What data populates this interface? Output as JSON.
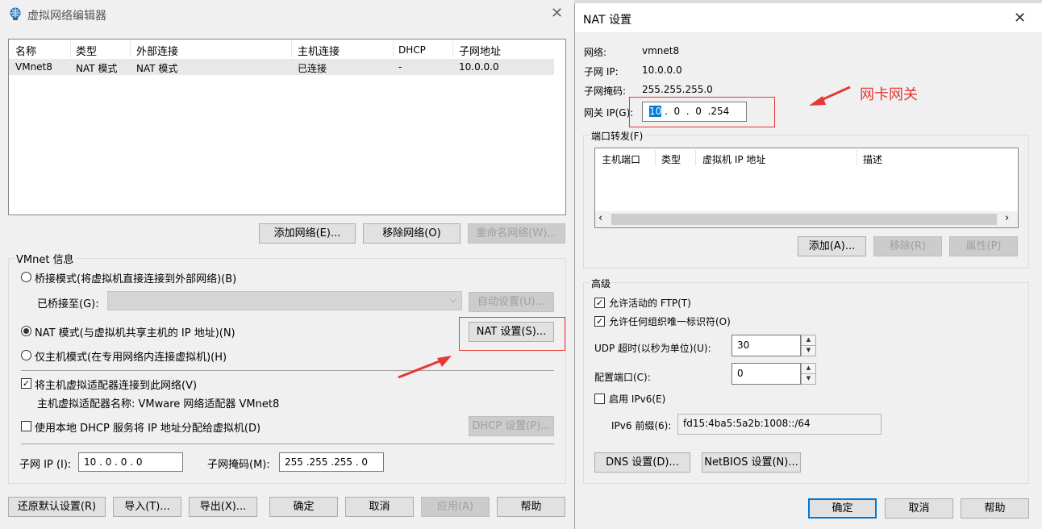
{
  "left": {
    "title": "虚拟网络编辑器",
    "table": {
      "headers": [
        "名称",
        "类型",
        "外部连接",
        "主机连接",
        "DHCP",
        "子网地址"
      ],
      "rows": [
        [
          "VMnet8",
          "NAT 模式",
          "NAT 模式",
          "已连接",
          "-",
          "10.0.0.0"
        ]
      ]
    },
    "buttons": {
      "add_network": "添加网络(E)...",
      "remove_network": "移除网络(O)",
      "rename_network": "重命名网络(W)..."
    },
    "vmnet_info": {
      "group_label": "VMnet 信息",
      "bridged": "桥接模式(将虚拟机直接连接到外部网络)(B)",
      "bridged_to_label": "已桥接至(G):",
      "auto_settings": "自动设置(U)...",
      "nat": "NAT 模式(与虚拟机共享主机的 IP 地址)(N)",
      "nat_settings": "NAT 设置(S)...",
      "host_only": "仅主机模式(在专用网络内连接虚拟机)(H)",
      "connect_adapter": "将主机虚拟适配器连接到此网络(V)",
      "adapter_name": "主机虚拟适配器名称: VMware 网络适配器 VMnet8",
      "use_dhcp": "使用本地 DHCP 服务将 IP 地址分配给虚拟机(D)",
      "dhcp_settings": "DHCP 设置(P)...",
      "subnet_ip_label": "子网 IP (I):",
      "subnet_ip": "10 . 0 . 0 . 0",
      "subnet_mask_label": "子网掩码(M):",
      "subnet_mask": "255 .255 .255 . 0"
    },
    "bottom": {
      "restore": "还原默认设置(R)",
      "import": "导入(T)...",
      "export": "导出(X)...",
      "ok": "确定",
      "cancel": "取消",
      "apply": "应用(A)",
      "help": "帮助"
    }
  },
  "right": {
    "title": "NAT 设置",
    "network_label": "网络:",
    "network": "vmnet8",
    "subnet_ip_label": "子网 IP:",
    "subnet_ip": "10.0.0.0",
    "subnet_mask_label": "子网掩码:",
    "subnet_mask": "255.255.255.0",
    "gateway_label": "网关 IP(G):",
    "gateway_sel": "10",
    "gateway_rest": " .  0  .  0  .254",
    "port_forward_label": "端口转发(F)",
    "pf_headers": [
      "主机端口",
      "类型",
      "虚拟机 IP 地址",
      "描述"
    ],
    "pf_add": "添加(A)...",
    "pf_remove": "移除(R)",
    "pf_props": "属性(P)",
    "advanced_label": "高级",
    "allow_ftp": "允许活动的 FTP(T)",
    "allow_uid": "允许任何组织唯一标识符(O)",
    "udp_timeout_label": "UDP 超时(以秒为单位)(U):",
    "udp_timeout": "30",
    "config_port_label": "配置端口(C):",
    "config_port": "0",
    "enable_ipv6": "启用 IPv6(E)",
    "ipv6_prefix_label": "IPv6 前缀(6):",
    "ipv6_prefix": "fd15:4ba5:5a2b:1008::/64",
    "dns_settings": "DNS 设置(D)...",
    "netbios_settings": "NetBIOS 设置(N)...",
    "ok": "确定",
    "cancel": "取消",
    "help": "帮助"
  },
  "annotation": {
    "text": "网卡网关",
    "color": "#e53935"
  }
}
